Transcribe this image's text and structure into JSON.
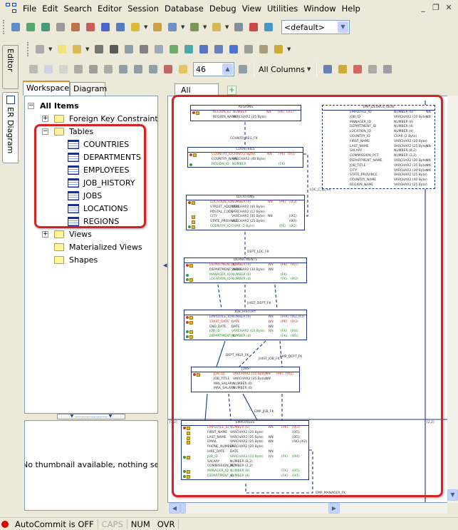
{
  "menu": [
    "File",
    "Edit",
    "Search",
    "Editor",
    "Session",
    "Database",
    "Debug",
    "View",
    "Utilities",
    "Window",
    "Help"
  ],
  "window_buttons": [
    "_",
    "❐",
    "✕"
  ],
  "toolbar1": {
    "icons": [
      {
        "name": "new-sql-window-icon",
        "color": "#4a7ac8"
      },
      {
        "name": "object-browser-icon",
        "color": "#3a9a5a"
      },
      {
        "name": "connect-icon",
        "color": "#2d8c6a"
      },
      {
        "name": "disconnect-icon",
        "color": "#8c8c8c"
      },
      {
        "name": "sql-icon",
        "color": "#b06030"
      },
      {
        "name": "schema-browser-icon",
        "color": "#c04848"
      },
      {
        "name": "bookmark-icon",
        "color": "#3050c0"
      },
      {
        "name": "editor-icon",
        "color": "#3a6ab8"
      },
      {
        "name": "wizard-icon",
        "color": "#d8b020"
      },
      {
        "name": "query-builder-icon",
        "color": "#c89030"
      },
      {
        "name": "session-icon",
        "color": "#5a80c0"
      },
      {
        "name": "report-icon",
        "color": "#6a8a40"
      },
      {
        "name": "database-icon",
        "color": "#d0b040"
      },
      {
        "name": "compare-icon",
        "color": "#708090"
      },
      {
        "name": "save-to-db-icon",
        "color": "#c03030"
      },
      {
        "name": "import-icon",
        "color": "#2a8ac0"
      }
    ],
    "profile_combo": "<default>"
  },
  "toolbar2": {
    "icons": [
      {
        "name": "relation-icon",
        "color": "#a0a0a0"
      },
      {
        "name": "new-diagram-icon",
        "color": "#f0e070"
      },
      {
        "name": "open-icon",
        "color": "#d8b040"
      },
      {
        "name": "save-all-icon",
        "color": "#606060"
      },
      {
        "name": "save-icon",
        "color": "#404040"
      },
      {
        "name": "print-preview-icon",
        "color": "#8090a0"
      },
      {
        "name": "print-icon",
        "color": "#707070"
      },
      {
        "name": "page-setup-icon",
        "color": "#90a0b0"
      },
      {
        "name": "add-table-icon",
        "color": "#5aa05a"
      },
      {
        "name": "add-entity-icon",
        "color": "#30a0a0"
      },
      {
        "name": "refresh-icon",
        "color": "#3a60c0"
      },
      {
        "name": "layout-icon",
        "color": "#5070b0"
      },
      {
        "name": "web-icon",
        "color": "#3060d0"
      },
      {
        "name": "copy-icon",
        "color": "#909090"
      },
      {
        "name": "paste-icon",
        "color": "#a09070"
      },
      {
        "name": "generate-icon",
        "color": "#c8a020"
      }
    ]
  },
  "toolbar3": {
    "icons_left": [
      {
        "name": "pan-hand-icon",
        "color": "#b0b0b0"
      },
      {
        "name": "select-pointer-icon",
        "color": "#c8d0e0"
      },
      {
        "name": "note-icon",
        "color": "#d0d0d0"
      },
      {
        "name": "multi-page-icon",
        "color": "#a0a0a0"
      },
      {
        "name": "table-view-icon",
        "color": "#909090"
      },
      {
        "name": "column-list-icon",
        "color": "#a0a0a0"
      },
      {
        "name": "zoom-icon",
        "color": "#8090a0"
      },
      {
        "name": "zoom-out-icon",
        "color": "#8090a0"
      },
      {
        "name": "zoom-in-icon",
        "color": "#8090a0"
      },
      {
        "name": "zoom-fit-icon",
        "color": "#c05050"
      },
      {
        "name": "fit-page-icon",
        "color": "#e0c050"
      }
    ],
    "zoom_value": "46",
    "columns_mode": "All Columns",
    "icons_right": [
      {
        "name": "align-top-icon",
        "color": "#5070b0"
      },
      {
        "name": "align-center-icon",
        "color": "#c8a020"
      },
      {
        "name": "snap-grid-icon",
        "color": "#d05050"
      },
      {
        "name": "grid-icon",
        "color": "#a0a0a0"
      },
      {
        "name": "grid-settings-icon",
        "color": "#9090a0"
      }
    ]
  },
  "side_tabs": [
    "Editor",
    "ER Diagram"
  ],
  "left_panel": {
    "tabs": [
      "Workspace",
      "Diagram"
    ],
    "tree": {
      "root": "All Items",
      "foreign_keys": "Foreign Key Constraints",
      "tables_label": "Tables",
      "tables": [
        "COUNTRIES",
        "DEPARTMENTS",
        "EMPLOYEES",
        "JOB_HISTORY",
        "JOBS",
        "LOCATIONS",
        "REGIONS"
      ],
      "views": "Views",
      "materialized_views": "Materialized Views",
      "shapes": "Shapes"
    },
    "thumbnail_text": "No thumbnail available, nothing selected"
  },
  "diagram": {
    "tab": "All Items",
    "page_labels": [
      "[1,2]",
      "[2,2]"
    ],
    "entities": [
      {
        "id": "regions",
        "title": "REGIONS",
        "rows": [
          [
            "REGION_ID",
            "NUMBER",
            "NN",
            "(PK)",
            "(IX1)",
            "k"
          ],
          [
            "REGION_NAME",
            "VARCHAR2 (25 Byte)",
            "",
            "",
            "",
            ""
          ]
        ]
      },
      {
        "id": "countries",
        "title": "COUNTRIES",
        "rows": [
          [
            "COUNTRY_ID",
            "CHAR (2 Byte)",
            "NN",
            "(PK)",
            "(IX1)",
            "k"
          ],
          [
            "COUNTRY_NAME",
            "VARCHAR2 (40 Byte)",
            "",
            "",
            "",
            ""
          ],
          [
            "REGION_ID",
            "NUMBER",
            "",
            "(FK)",
            "",
            "f"
          ]
        ]
      },
      {
        "id": "emp_details_view",
        "title": "EMP_DETAILS_VIEW",
        "view": true,
        "rows": [
          [
            "EMPLOYEE_ID",
            "NUMBER (6)",
            "NN",
            "",
            "",
            ""
          ],
          [
            "JOB_ID",
            "VARCHAR2 (10 Byte)",
            "NN",
            "",
            "",
            ""
          ],
          [
            "MANAGER_ID",
            "NUMBER (6)",
            "",
            "",
            "",
            ""
          ],
          [
            "DEPARTMENT_ID",
            "NUMBER (4)",
            "",
            "",
            "",
            ""
          ],
          [
            "LOCATION_ID",
            "NUMBER (4)",
            "",
            "",
            "",
            ""
          ],
          [
            "COUNTRY_ID",
            "CHAR (2 Byte)",
            "",
            "",
            "",
            ""
          ],
          [
            "FIRST_NAME",
            "VARCHAR2 (20 Byte)",
            "",
            "",
            "",
            ""
          ],
          [
            "LAST_NAME",
            "VARCHAR2 (25 Byte)",
            "NN",
            "",
            "",
            ""
          ],
          [
            "SALARY",
            "NUMBER (8,2)",
            "",
            "",
            "",
            ""
          ],
          [
            "COMMISSION_PCT",
            "NUMBER (2,2)",
            "",
            "",
            "",
            ""
          ],
          [
            "DEPARTMENT_NAME",
            "VARCHAR2 (30 Byte)",
            "NN",
            "",
            "",
            ""
          ],
          [
            "JOB_TITLE",
            "VARCHAR2 (35 Byte)",
            "NN",
            "",
            "",
            ""
          ],
          [
            "CITY",
            "VARCHAR2 (30 Byte)",
            "NN",
            "",
            "",
            ""
          ],
          [
            "STATE_PROVINCE",
            "VARCHAR2 (25 Byte)",
            "",
            "",
            "",
            ""
          ],
          [
            "COUNTRY_NAME",
            "VARCHAR2 (40 Byte)",
            "",
            "",
            "",
            ""
          ],
          [
            "REGION_NAME",
            "VARCHAR2 (25 Byte)",
            "",
            "",
            "",
            ""
          ]
        ]
      },
      {
        "id": "locations",
        "title": "LOCATIONS",
        "rows": [
          [
            "LOCATION_ID",
            "NUMBER (4)",
            "NN",
            "(PK)",
            "(IX3)",
            "k"
          ],
          [
            "STREET_ADDRESS",
            "VARCHAR2 (40 Byte)",
            "",
            "",
            "",
            ""
          ],
          [
            "POSTAL_CODE",
            "VARCHAR2 (12 Byte)",
            "",
            "",
            "",
            ""
          ],
          [
            "CITY",
            "VARCHAR2 (30 Byte)",
            "NN",
            "",
            "(IX1)",
            ""
          ],
          [
            "STATE_PROVINCE",
            "VARCHAR2 (25 Byte)",
            "",
            "",
            "(IX4)",
            ""
          ],
          [
            "COUNTRY_ID",
            "CHAR (2 Byte)",
            "",
            "(FK)",
            "(IX2)",
            "f"
          ]
        ]
      },
      {
        "id": "departments",
        "title": "DEPARTMENTS",
        "rows": [
          [
            "DEPARTMENT_ID",
            "NUMBER (4)",
            "NN",
            "(PK)",
            "(IX1)",
            "k"
          ],
          [
            "DEPARTMENT_NAME",
            "VARCHAR2 (30 Byte)",
            "NN",
            "",
            "",
            ""
          ],
          [
            "MANAGER_ID",
            "NUMBER (6)",
            "",
            "(FK)",
            "",
            "f"
          ],
          [
            "LOCATION_ID",
            "NUMBER (4)",
            "",
            "(FK)",
            "(IX2)",
            "f"
          ]
        ]
      },
      {
        "id": "job_history",
        "title": "JOB_HISTORY",
        "rows": [
          [
            "EMPLOYEE_ID",
            "NUMBER (6)",
            "NN",
            "(PFK)",
            "(IX2,IX3)",
            "kf"
          ],
          [
            "START_DATE",
            "DATE",
            "NN",
            "(PK)",
            "(IX3)",
            "k"
          ],
          [
            "END_DATE",
            "DATE",
            "NN",
            "",
            "",
            ""
          ],
          [
            "JOB_ID",
            "VARCHAR2 (10 Byte)",
            "NN",
            "(FK)",
            "(IX4)",
            "f"
          ],
          [
            "DEPARTMENT_ID",
            "NUMBER (4)",
            "",
            "(FK)",
            "(IX1)",
            "f"
          ]
        ]
      },
      {
        "id": "jobs",
        "title": "JOBS",
        "rows": [
          [
            "JOB_ID",
            "VARCHAR2 (10 Byte)",
            "NN",
            "(PK)",
            "(IX1)",
            "k"
          ],
          [
            "JOB_TITLE",
            "VARCHAR2 (35 Byte)",
            "NN",
            "",
            "",
            ""
          ],
          [
            "MIN_SALARY",
            "NUMBER (6)",
            "",
            "",
            "",
            ""
          ],
          [
            "MAX_SALARY",
            "NUMBER (6)",
            "",
            "",
            "",
            ""
          ]
        ]
      },
      {
        "id": "employees",
        "title": "EMPLOYEES",
        "rows": [
          [
            "EMPLOYEE_ID",
            "NUMBER (6)",
            "NN",
            "(PK)",
            "(IX3)",
            "k"
          ],
          [
            "FIRST_NAME",
            "VARCHAR2 (20 Byte)",
            "",
            "",
            "(IX5)",
            ""
          ],
          [
            "LAST_NAME",
            "VARCHAR2 (25 Byte)",
            "NN",
            "",
            "(IX5)",
            ""
          ],
          [
            "EMAIL",
            "VARCHAR2 (25 Byte)",
            "NN",
            "",
            "(AK1,IX2)",
            ""
          ],
          [
            "PHONE_NUMBER",
            "VARCHAR2 (20 Byte)",
            "",
            "",
            "",
            ""
          ],
          [
            "HIRE_DATE",
            "DATE",
            "NN",
            "",
            "",
            ""
          ],
          [
            "JOB_ID",
            "VARCHAR2 (10 Byte)",
            "NN",
            "(FK)",
            "(IX4)",
            "f"
          ],
          [
            "SALARY",
            "NUMBER (8,2)",
            "",
            "",
            "",
            ""
          ],
          [
            "COMMISSION_PCT",
            "NUMBER (2,2)",
            "",
            "",
            "",
            ""
          ],
          [
            "MANAGER_ID",
            "NUMBER (6)",
            "",
            "(FK)",
            "(IX5)",
            "f"
          ],
          [
            "DEPARTMENT_ID",
            "NUMBER (4)",
            "",
            "(FK)",
            "(IX1)",
            "f"
          ]
        ]
      }
    ],
    "relations": [
      "COUNTR_REG_FK",
      "LOC_C_ID_FK",
      "DEPT_LOC_FK",
      "JHIST_DEPT_FK",
      "DEPT_MGR_FK",
      "JHIST_JOB_FK",
      "EMP_DEPT_FK",
      "EMP_JOB_FK",
      "EMP_MANAGER_FK"
    ]
  },
  "status": {
    "autocommit": "AutoCommit is OFF",
    "caps": "CAPS",
    "num": "NUM",
    "ovr": "OVR"
  }
}
